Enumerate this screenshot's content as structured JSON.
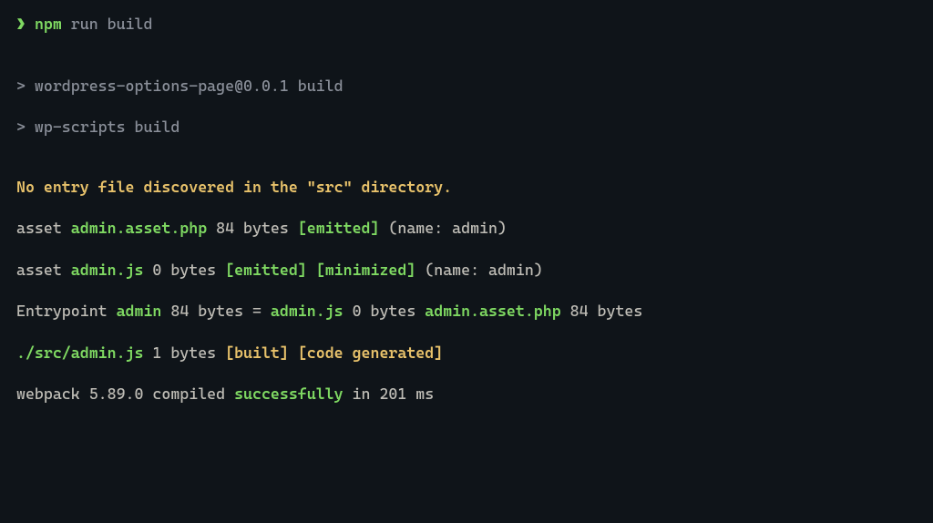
{
  "prompt": {
    "arrow": "❯",
    "cmd_head": "npm",
    "cmd_rest": " run build"
  },
  "script_lines": {
    "l1_prefix": "> ",
    "l1_text": "wordpress-options-page@0.0.1 build",
    "l2_prefix": "> ",
    "l2_text": "wp-scripts build"
  },
  "warn": "No entry file discovered in the \"src\" directory.",
  "asset1": {
    "pre": "asset ",
    "name": "admin.asset.php",
    "size": " 84 bytes ",
    "tag1": "[emitted]",
    "post": " (name: admin)"
  },
  "asset2": {
    "pre": "asset ",
    "name": "admin.js",
    "size": " 0 bytes ",
    "tag1": "[emitted]",
    "sep": " ",
    "tag2": "[minimized]",
    "post": " (name: admin)"
  },
  "entry": {
    "pre": "Entrypoint ",
    "name": "admin",
    "mid1": " 84 bytes = ",
    "f1": "admin.js",
    "mid2": " 0 bytes ",
    "f2": "admin.asset.php",
    "post": " 84 bytes"
  },
  "src": {
    "file": "./src/admin.js",
    "size": " 1 bytes ",
    "tag1": "[built]",
    "sep": " ",
    "tag2": "[code generated]"
  },
  "webpack": {
    "pre": "webpack 5.89.0 compiled ",
    "ok": "successfully",
    "post": " in 201 ms"
  }
}
